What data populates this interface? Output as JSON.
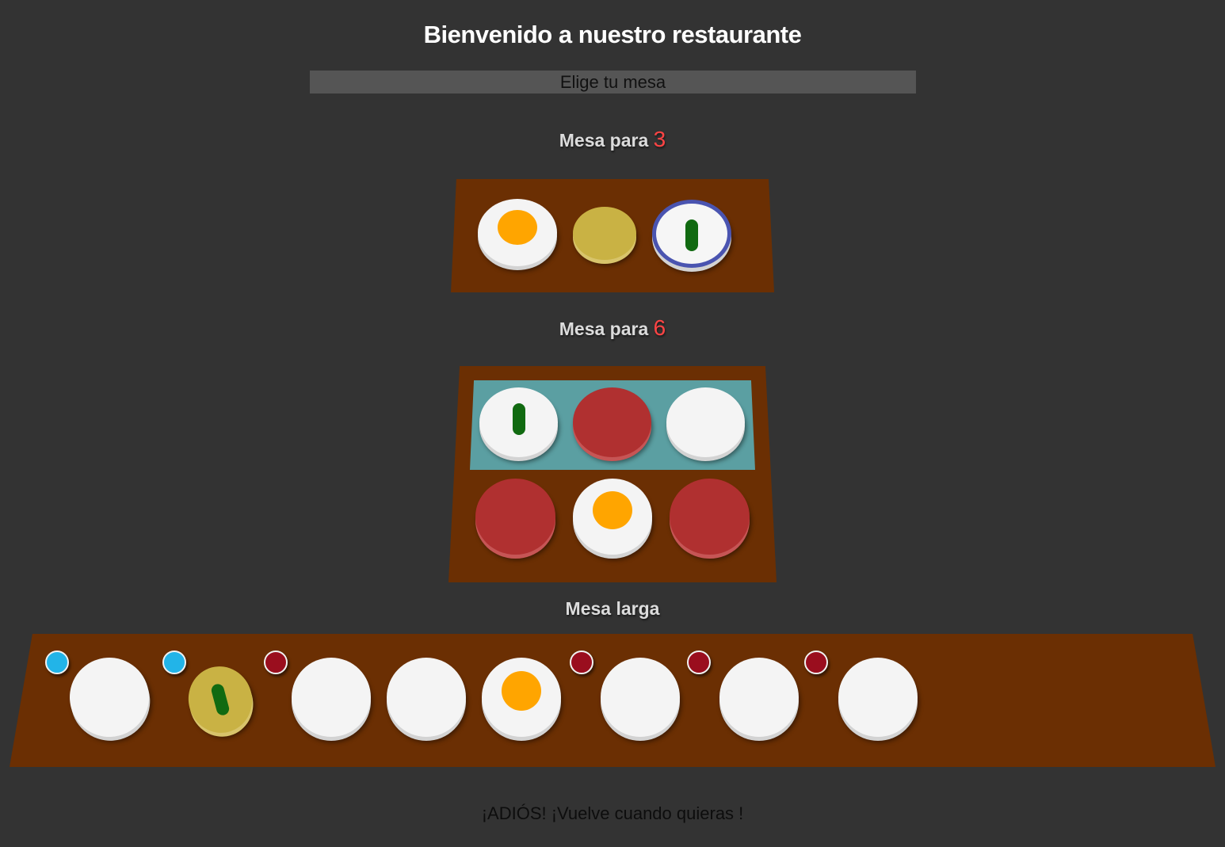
{
  "header": {
    "title": "Bienvenido a nuestro restaurante",
    "choose_label": "Elige tu mesa"
  },
  "tables": [
    {
      "label_prefix": "Mesa para",
      "label_number": "3",
      "seats": [
        {
          "plate": "white",
          "item": "egg"
        },
        {
          "plate": "gold",
          "item": "none"
        },
        {
          "plate": "white-ringed",
          "item": "stick"
        }
      ]
    },
    {
      "label_prefix": "Mesa para",
      "label_number": "6",
      "highlighted_row": 1,
      "seats": [
        {
          "plate": "white",
          "item": "stick"
        },
        {
          "plate": "red",
          "item": "none"
        },
        {
          "plate": "white",
          "item": "none"
        },
        {
          "plate": "red",
          "item": "none"
        },
        {
          "plate": "white",
          "item": "egg"
        },
        {
          "plate": "red",
          "item": "none"
        }
      ]
    },
    {
      "label": "Mesa larga",
      "markers": [
        "blue",
        "blue",
        "dark-red",
        "dark-red",
        "dark-red",
        "dark-red"
      ],
      "seats": [
        {
          "plate": "white",
          "item": "none"
        },
        {
          "plate": "gold",
          "item": "stick"
        },
        {
          "plate": "white",
          "item": "none"
        },
        {
          "plate": "white",
          "item": "none"
        },
        {
          "plate": "white",
          "item": "egg"
        },
        {
          "plate": "white",
          "item": "none"
        },
        {
          "plate": "white",
          "item": "none"
        },
        {
          "plate": "white",
          "item": "none"
        }
      ]
    }
  ],
  "footer": {
    "text": "¡ADIÓS! ¡Vuelve cuando quieras !"
  },
  "colors": {
    "background": "#333333",
    "table": "#6b2f03",
    "highlight_panel": "#5b9fa2",
    "plate_white": "#f4f4f4",
    "plate_red": "#b03030",
    "plate_gold": "#c9b244",
    "egg_yolk": "#ffa500",
    "stick": "#116a11",
    "marker_blue": "#22b4e8",
    "marker_dark_red": "#9a0e1e",
    "label_number": "#ff4444"
  }
}
